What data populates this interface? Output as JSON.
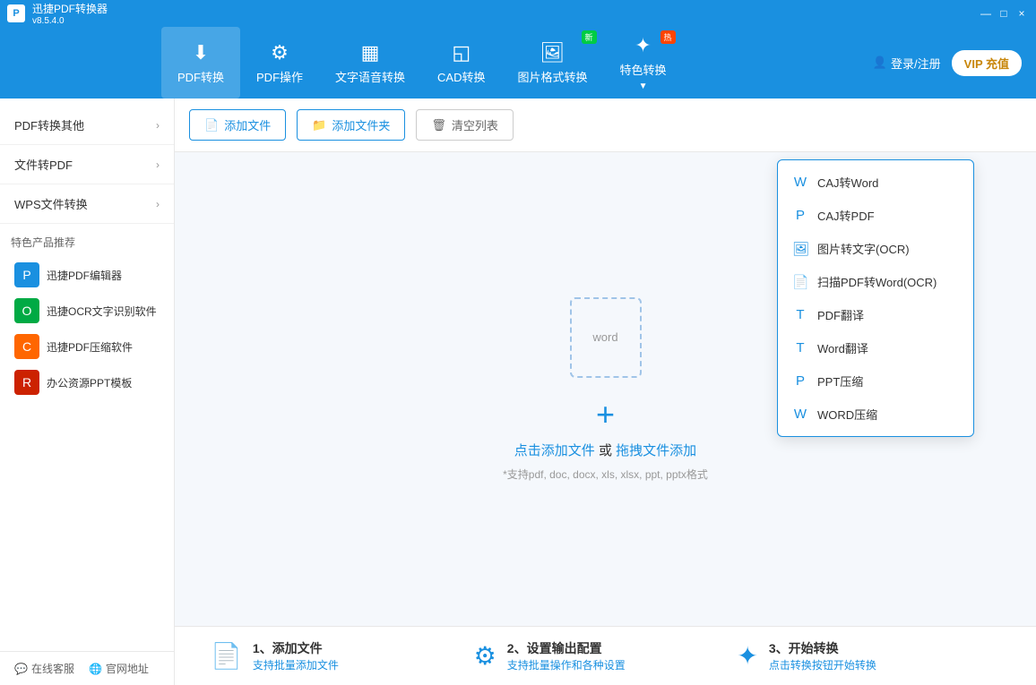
{
  "titleBar": {
    "appName": "迅捷PDF转换器",
    "version": "v8.5.4.0",
    "controls": [
      "—",
      "□",
      "×"
    ]
  },
  "nav": {
    "items": [
      {
        "id": "pdf-convert",
        "label": "PDF转换",
        "active": true,
        "badge": null
      },
      {
        "id": "pdf-op",
        "label": "PDF操作",
        "active": false,
        "badge": null
      },
      {
        "id": "text-voice",
        "label": "文字语音转换",
        "active": false,
        "badge": null
      },
      {
        "id": "cad",
        "label": "CAD转换",
        "active": false,
        "badge": null
      },
      {
        "id": "image-format",
        "label": "图片格式转换",
        "active": false,
        "badge": "新"
      },
      {
        "id": "special",
        "label": "特色转换",
        "active": false,
        "badge": "热"
      }
    ],
    "loginLabel": "登录/注册",
    "vipLabel": "VIP 充值"
  },
  "sidebar": {
    "sections": [
      {
        "label": "PDF转换其他"
      },
      {
        "label": "文件转PDF"
      },
      {
        "label": "WPS文件转换"
      }
    ],
    "products": {
      "title": "特色产品推荐",
      "items": [
        {
          "name": "迅捷PDF编辑器",
          "iconColor": "blue"
        },
        {
          "name": "迅捷OCR文字识别软件",
          "iconColor": "green"
        },
        {
          "name": "迅捷PDF压缩软件",
          "iconColor": "orange"
        },
        {
          "name": "办公资源PPT模板",
          "iconColor": "red"
        }
      ]
    },
    "footer": [
      {
        "label": "在线客服"
      },
      {
        "label": "官网地址"
      }
    ]
  },
  "toolbar": {
    "addFile": "添加文件",
    "addFolder": "添加文件夹",
    "clearList": "清空列表"
  },
  "dropArea": {
    "wordPlaceholder": "word",
    "addText": "点击添加文件",
    "orText": "或",
    "dragText": "拖拽文件添加",
    "hint": "*支持pdf, doc, docx, xls, xlsx, ppt, pptx格式"
  },
  "dropdown": {
    "items": [
      {
        "label": "CAJ转Word"
      },
      {
        "label": "CAJ转PDF"
      },
      {
        "label": "图片转文字(OCR)"
      },
      {
        "label": "扫描PDF转Word(OCR)"
      },
      {
        "label": "PDF翻译"
      },
      {
        "label": "Word翻译"
      },
      {
        "label": "PPT压缩"
      },
      {
        "label": "WORD压缩"
      }
    ]
  },
  "guide": {
    "steps": [
      {
        "num": "1",
        "title": "1、添加文件",
        "sub": "支持批量添加文件"
      },
      {
        "num": "2",
        "title": "2、设置输出配置",
        "sub": "支持批量操作和各种设置"
      },
      {
        "num": "3",
        "title": "3、开始转换",
        "sub": "点击转换按钮开始转换"
      }
    ]
  }
}
